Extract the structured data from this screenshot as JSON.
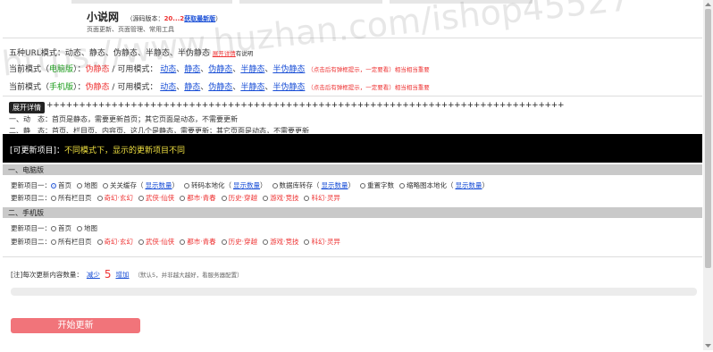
{
  "header": {
    "title": "小说网",
    "version_prefix": "（源码版本：",
    "version_num": "20...2",
    "version_link": "获取最新版",
    "version_suffix": "）",
    "subtitle": "页面更新、页面管理、常用工具"
  },
  "url_modes": {
    "line1_text": "五种URL模式：动态、静态、伪静态、半静态、半伪静态",
    "line1_link": "展开详情",
    "line1_tail": "有说明",
    "pc_line_prefix": "当前模式（",
    "pc_label": "电脑版",
    "pc_mid": "）：",
    "pc_current": "伪静态",
    "pc_avail_label": "可用模式：",
    "pc_modes": [
      "动态",
      "静态",
      "伪静态",
      "半静态",
      "半伪静态"
    ],
    "pc_hint": "（点击后有弹框提示，一定要看）相当相当重要",
    "m_line_prefix": "当前模式（",
    "m_label": "手机版",
    "m_mid": "）：",
    "m_current": "伪静态",
    "m_avail_label": "可用模式：",
    "m_modes": [
      "动态",
      "静态",
      "伪静态",
      "半静态",
      "半伪静态"
    ],
    "m_hint": "（点击后有弹框提示，一定要看）相当相当重要"
  },
  "details": {
    "button": "展开详情",
    "pluses": "++++++++++++++++++++++++++++++++++++++++++++++++++++++++++++++++++++++++++++++++",
    "line1": "一、动　态：首页是静态，需要更新首页；其它页面是动态，不需要更新",
    "line2": "二、静　态：首页、栏目页、内容页、这几个是静态，需要更新；其它页面是动态，不需要更新"
  },
  "banner": {
    "prefix": "[可更新项目]：",
    "highlight": "不同模式下，显示的更新项目不同"
  },
  "pc_section": {
    "title": "一、电脑版",
    "row1_label": "更新项目一：",
    "row1_options": [
      {
        "label": "首页",
        "checked": true,
        "link": ""
      },
      {
        "label": "地图",
        "checked": false,
        "link": ""
      },
      {
        "label": "关关缓存",
        "checked": false,
        "link": "显示数量"
      },
      {
        "label": "转码本地化",
        "checked": false,
        "link": "显示数量"
      },
      {
        "label": "数据库转存",
        "checked": false,
        "link": "显示数量"
      },
      {
        "label": "重置字数",
        "checked": false,
        "link": ""
      },
      {
        "label": "缩略图本地化",
        "checked": false,
        "link": "显示数量"
      }
    ],
    "row2_label": "更新项目二：",
    "row2_options": [
      "所有栏目页",
      "奇幻·玄幻",
      "武侠·仙侠",
      "都市·青春",
      "历史·穿越",
      "游戏·竞技",
      "科幻·灵异"
    ]
  },
  "m_section": {
    "title": "二、手机版",
    "row1_label": "更新项目一：",
    "row1_options": [
      "首页",
      "地图"
    ],
    "row2_label": "更新项目二：",
    "row2_options": [
      "所有栏目页",
      "奇幻·玄幻",
      "武侠·仙侠",
      "都市·青春",
      "历史·穿越",
      "游戏·竞技",
      "科幻·灵异"
    ]
  },
  "quantity": {
    "label": "[注]每次更新内容数量：",
    "decrease": "减少",
    "value": "5",
    "increase": "增加",
    "hint": "（默认5，并非越大越好，看服务器配置）"
  },
  "progress": {
    "value": 0
  },
  "start_button": "开始更新",
  "watermark": "https://www.huzhan.com/ishop45527",
  "colors": {
    "accent_red": "#e33333",
    "link_blue": "#1a4fd6",
    "green": "#1a9c1a",
    "button": "#f1747a",
    "banner_bg": "#000000",
    "banner_highlight": "#f0e040"
  }
}
